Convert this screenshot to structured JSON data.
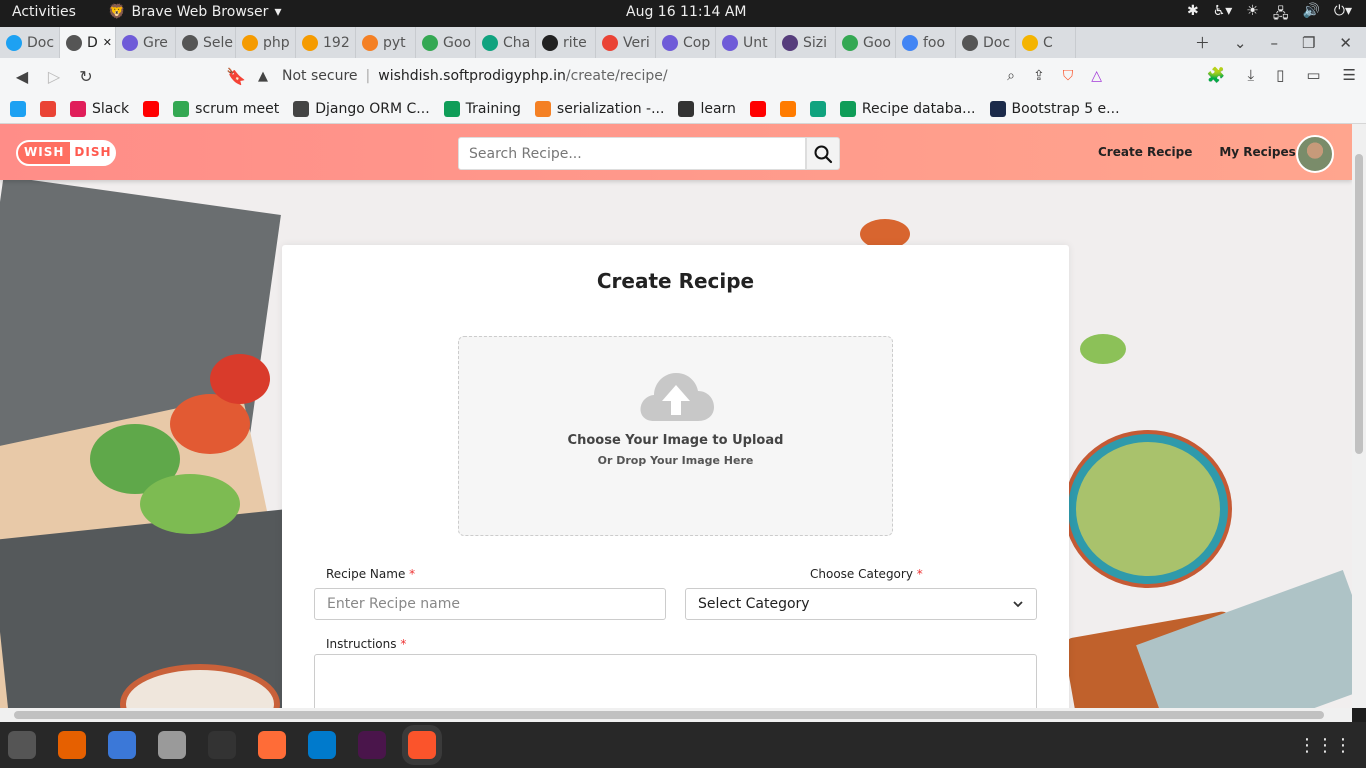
{
  "system": {
    "activities": "Activities",
    "app_name": "Brave Web Browser",
    "clock": "Aug 16  11:14 AM"
  },
  "tabs": [
    {
      "label": "Doc",
      "color": "#1da1f2",
      "icon": "globe-icon"
    },
    {
      "label": "D",
      "color": "#555555",
      "icon": "globe-icon",
      "active": true
    },
    {
      "label": "Gre",
      "color": "#6f5bd8",
      "icon": "copilot-icon"
    },
    {
      "label": "Sele",
      "color": "#555555",
      "icon": "globe-icon"
    },
    {
      "label": "php",
      "color": "#f59b00",
      "icon": "phpmyadmin-icon"
    },
    {
      "label": "192",
      "color": "#f59b00",
      "icon": "phpmyadmin-icon"
    },
    {
      "label": "pyt",
      "color": "#f48024",
      "icon": "stackoverflow-icon"
    },
    {
      "label": "Goo",
      "color": "#34a853",
      "icon": "meet-icon"
    },
    {
      "label": "Cha",
      "color": "#10a37f",
      "icon": "chatgpt-icon"
    },
    {
      "label": "rite",
      "color": "#222222",
      "icon": "github-icon"
    },
    {
      "label": "Veri",
      "color": "#ea4335",
      "icon": "gmail-icon"
    },
    {
      "label": "Cop",
      "color": "#6f5bd8",
      "icon": "copilot-icon"
    },
    {
      "label": "Unt",
      "color": "#6f5bd8",
      "icon": "copilot-icon"
    },
    {
      "label": "Sizi",
      "color": "#563d7c",
      "icon": "bootstrap-icon"
    },
    {
      "label": "Goo",
      "color": "#34a853",
      "icon": "meet-icon"
    },
    {
      "label": "foo",
      "color": "#4285f4",
      "icon": "google-icon"
    },
    {
      "label": "Doc",
      "color": "#555555",
      "icon": "globe-icon"
    },
    {
      "label": "C",
      "color": "#f4b400",
      "icon": "emoji-icon"
    }
  ],
  "address": {
    "security": "Not secure",
    "domain": "wishdish.softprodigyphp.in",
    "path": "/create/recipe/"
  },
  "bookmarks": [
    {
      "label": "",
      "color": "#1da1f2",
      "icon": "k-icon"
    },
    {
      "label": "",
      "color": "#ea4335",
      "icon": "gmail-icon"
    },
    {
      "label": "Slack",
      "color": "#e01e5a",
      "icon": "slack-icon"
    },
    {
      "label": "",
      "color": "#ff0000",
      "icon": "youtube-icon"
    },
    {
      "label": "scrum meet",
      "color": "#34a853",
      "icon": "meet-icon"
    },
    {
      "label": "Django ORM C...",
      "color": "#444444",
      "icon": "doc-icon"
    },
    {
      "label": "Training",
      "color": "#0f9d58",
      "icon": "sheets-icon"
    },
    {
      "label": "serialization -...",
      "color": "#f48024",
      "icon": "stackoverflow-icon"
    },
    {
      "label": "learn",
      "color": "#333333",
      "icon": "globe-icon"
    },
    {
      "label": "",
      "color": "#ff0000",
      "icon": "youtube-icon"
    },
    {
      "label": "",
      "color": "#ff7b00",
      "icon": "food-icon"
    },
    {
      "label": "",
      "color": "#10a37f",
      "icon": "chatgpt-icon"
    },
    {
      "label": "Recipe databa...",
      "color": "#0f9d58",
      "icon": "sheets-icon"
    },
    {
      "label": "Bootstrap 5 e...",
      "color": "#1b2a4a",
      "icon": "bootstrap-icon"
    }
  ],
  "site": {
    "logo_part1": "WISH",
    "logo_part2": "DISH",
    "search_placeholder": "Search Recipe...",
    "nav_create": "Create Recipe",
    "nav_my": "My Recipes"
  },
  "form": {
    "title": "Create Recipe",
    "upload_title": "Choose Your Image to Upload",
    "upload_sub": "Or Drop Your Image Here",
    "recipe_name_label": "Recipe Name",
    "recipe_name_placeholder": "Enter Recipe name",
    "category_label": "Choose Category",
    "category_value": "Select Category",
    "instructions_label": "Instructions",
    "required_mark": "*"
  },
  "colors": {
    "header_start": "#ff8d88",
    "header_end": "#ffa58e",
    "logo_accent": "#ff6f61",
    "required": "#e33333"
  },
  "dock": [
    {
      "name": "settings-app",
      "color": "#555555"
    },
    {
      "name": "firefox-app",
      "color": "#e66000"
    },
    {
      "name": "text-editor-app",
      "color": "#3b78d8"
    },
    {
      "name": "files-app",
      "color": "#9a9a9a"
    },
    {
      "name": "terminal-app",
      "color": "#333333"
    },
    {
      "name": "postman-app",
      "color": "#ff6c37"
    },
    {
      "name": "vscode-app",
      "color": "#007acc"
    },
    {
      "name": "slack-app",
      "color": "#4a154b"
    },
    {
      "name": "brave-app",
      "color": "#fb542b",
      "active": true
    }
  ]
}
